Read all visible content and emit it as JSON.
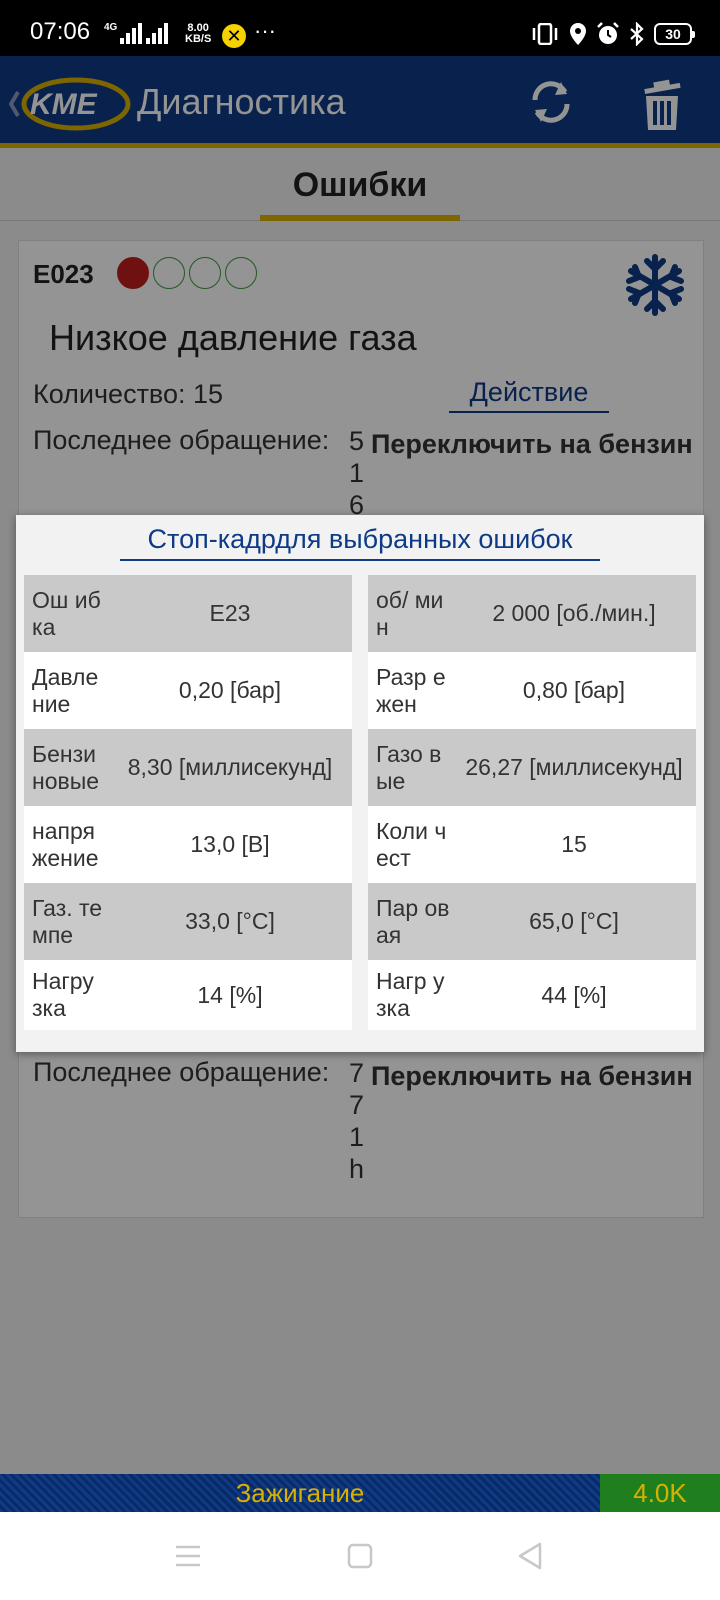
{
  "status_bar": {
    "time": "07:06",
    "network_tag": "4G",
    "speed_value": "8.00",
    "speed_unit": "KB/S",
    "more": "···",
    "battery": "30"
  },
  "app": {
    "title": "Диагностика",
    "accent_color": "#0e3a86",
    "highlight_color": "#d8b000"
  },
  "tabs": {
    "active": "Ошибки"
  },
  "error": {
    "code": "E023",
    "lights": [
      "red",
      "green",
      "green",
      "green"
    ],
    "title": "Низкое давление газа",
    "count_label": "Количество: 15",
    "action_label": "Действие",
    "last_label": "Последнее обращение:",
    "last_digits": [
      "5",
      "1",
      "6"
    ],
    "action_value": "Переключить на бензин",
    "last2_label": "Последнее обращение:",
    "last2_digits": [
      "7",
      "7",
      "1",
      "h"
    ],
    "action2_value": "Переключить на бензин"
  },
  "dialog": {
    "title": "Стоп-кадрдля выбранных ошибок",
    "left": [
      {
        "label": "Ош ибка",
        "value": "E23"
      },
      {
        "label": "Давле ние",
        "value": "0,20 [бар]"
      },
      {
        "label": "Бензи новые",
        "value": "8,30 [миллисекунд]"
      },
      {
        "label": "напря жение",
        "value": "13,0 [В]"
      },
      {
        "label": "Газ. темпе",
        "value": "33,0 [°C]"
      },
      {
        "label": "Нагру зка",
        "value": "14 [%]"
      }
    ],
    "right": [
      {
        "label": "об/ мин",
        "value": "2 000 [об./мин.]"
      },
      {
        "label": "Разр ежен",
        "value": "0,80 [бар]"
      },
      {
        "label": "Газо вые",
        "value": "26,27 [миллисекунд]"
      },
      {
        "label": "Коли чест",
        "value": "15"
      },
      {
        "label": "Пар овая",
        "value": "65,0 [°C]"
      },
      {
        "label": "Нагр узка",
        "value": "44 [%]"
      }
    ]
  },
  "bottom": {
    "ignition": "Зажигание",
    "k_value": "4.0K"
  }
}
